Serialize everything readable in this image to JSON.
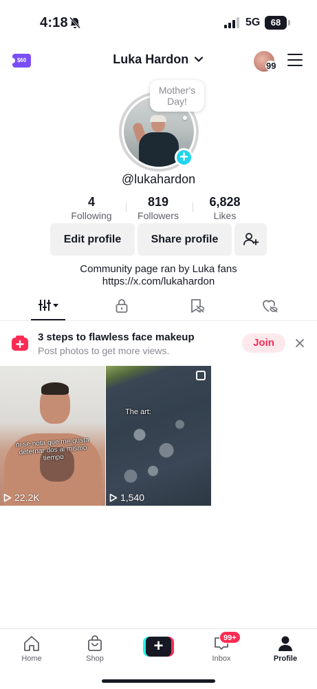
{
  "status_bar": {
    "time": "4:18",
    "network": "5G",
    "battery": "68"
  },
  "header": {
    "coin_label": "$60",
    "profile_name": "Luka Hardon",
    "friends_count": "99"
  },
  "note": {
    "line1": "Mother's",
    "line2": "Day!"
  },
  "profile": {
    "username": "@lukahardon",
    "stats": [
      {
        "value": "4",
        "label": "Following"
      },
      {
        "value": "819",
        "label": "Followers"
      },
      {
        "value": "6,828",
        "label": "Likes"
      }
    ],
    "edit_label": "Edit profile",
    "share_label": "Share profile",
    "bio_line1": "Community page ran by Luka fans",
    "bio_line2": "https://x.com/lukahardon"
  },
  "promo": {
    "title": "3 steps to flawless face makeup",
    "subtitle": "Post photos to get more views.",
    "join_label": "Join"
  },
  "videos": [
    {
      "views": "22.2K",
      "caption": "ni se nota que me gusta deternar dos al mismo tiempo"
    },
    {
      "views": "1,540",
      "caption": "The art:"
    }
  ],
  "nav": {
    "home": "Home",
    "shop": "Shop",
    "inbox": "Inbox",
    "inbox_badge": "99+",
    "profile": "Profile"
  },
  "colors": {
    "accent": "#fe2c55",
    "cyan": "#20d5ec",
    "purple": "#7b4ef5"
  }
}
